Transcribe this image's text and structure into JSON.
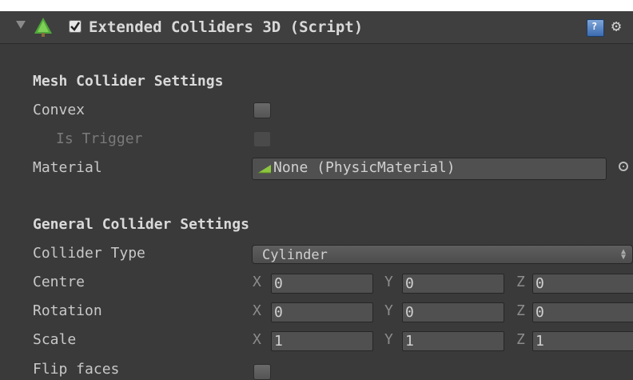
{
  "header": {
    "title": "Extended Colliders 3D (Script)",
    "enabled": true,
    "help_icon_text": "?"
  },
  "mesh_section": {
    "title": "Mesh Collider Settings",
    "convex_label": "Convex",
    "convex_checked": false,
    "is_trigger_label": "Is Trigger",
    "is_trigger_checked": false,
    "material_label": "Material",
    "material_value": "None (PhysicMaterial)"
  },
  "general_section": {
    "title": "General Collider Settings",
    "collider_type_label": "Collider Type",
    "collider_type_value": "Cylinder",
    "centre_label": "Centre",
    "rotation_label": "Rotation",
    "scale_label": "Scale",
    "flip_faces_label": "Flip faces",
    "flip_faces_checked": false,
    "axis_labels": {
      "x": "X",
      "y": "Y",
      "z": "Z"
    },
    "centre": {
      "x": "0",
      "y": "0",
      "z": "0"
    },
    "rotation": {
      "x": "0",
      "y": "0",
      "z": "0"
    },
    "scale": {
      "x": "1",
      "y": "1",
      "z": "1"
    }
  }
}
